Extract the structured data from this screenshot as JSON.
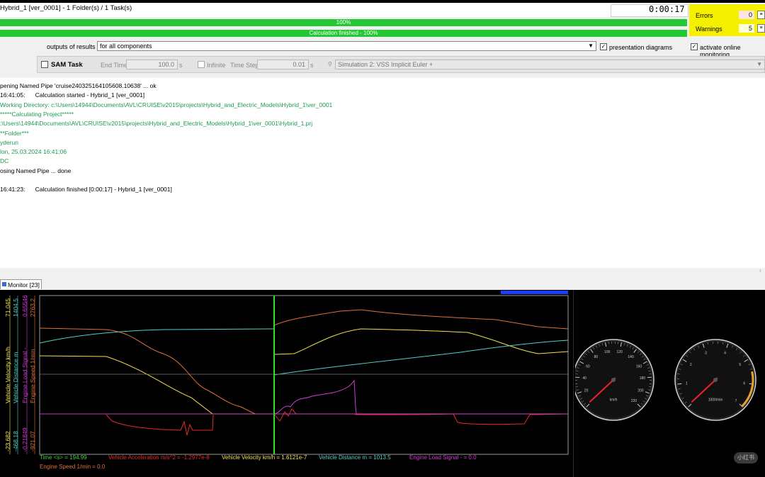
{
  "header": {
    "title": "Hybrid_1 [ver_0001] - 1 Folder(s) / 1 Task(s)",
    "timer": "0:00:17",
    "progress1_label": "100%",
    "progress1": 1.0,
    "progress2_label": "Calculation finished - 100%",
    "progress2": 1.0
  },
  "status": {
    "errors_label": "Errors",
    "errors_value": "0",
    "warnings_label": "Warnings",
    "warnings_value": "5"
  },
  "options": {
    "outputs_label": "outputs of results",
    "outputs_value": "for all components",
    "presentation_label": "presentation diagrams",
    "presentation_checked": true,
    "online_label": "activate online monitoring",
    "online_checked": true
  },
  "task": {
    "name": "SAM Task",
    "end_time_label": "End Time",
    "end_time_value": "100.0",
    "end_time_unit": "s",
    "infinite_label": "Infinite",
    "time_step_label": "Time Step",
    "time_step_value": "0.01",
    "time_step_unit": "s",
    "simulation": "Simulation 2: VSS Implicit Euler +"
  },
  "log": [
    {
      "text": "pening Named Pipe 'cruise240325164105608.10638' ... ok",
      "color": "#000000"
    },
    {
      "text": "16:41:05:      Calculation started - Hybrid_1 [ver_0001]",
      "color": "#000000"
    },
    {
      "text": "Working Directory: c:\\Users\\14944\\Documents\\AVL\\CRUISE\\v2015\\projects\\Hybrid_and_Electric_Models\\Hybrid_1\\ver_0001",
      "color": "#1f9a52"
    },
    {
      "text": "*****Calculating Project*****",
      "color": "#1f9a52"
    },
    {
      "text": ":\\Users\\14944\\Documents\\AVL\\CRUISE\\v2015\\projects\\Hybrid_and_Electric_Models\\Hybrid_1\\ver_0001\\Hybrid_1.prj",
      "color": "#1f9a52"
    },
    {
      "text": "**Folder***",
      "color": "#1f9a52"
    },
    {
      "text": "yderun",
      "color": "#1f9a52"
    },
    {
      "text": "lon, 25.03.2024 16:41:06",
      "color": "#1f9a52"
    },
    {
      "text": "DC",
      "color": "#1f9a52"
    },
    {
      "text": "osing Named Pipe ... done",
      "color": "#000000"
    },
    {
      "text": "",
      "color": "#000000"
    },
    {
      "text": "16:41:23:      Calculation finished [0:00:17] - Hybrid_1 [ver_0001]",
      "color": "#000000"
    }
  ],
  "monitor": {
    "tab_label": "Monitor [23]",
    "axes": [
      {
        "name": "Vehicle Velocity km/h",
        "max": "71.045",
        "min": "-23.682",
        "color": "#f2e14a"
      },
      {
        "name": "Vehicle Distance m",
        "max": "1404.5",
        "min": "-468.18",
        "color": "#4fd3c8"
      },
      {
        "name": "Engine Load Signal -",
        "max": "0.65546",
        "min": "-0.21849",
        "color": "#d23cd2"
      },
      {
        "name": "Engine Speed 1/min",
        "max": "2763.2",
        "min": "-921.07",
        "color": "#e0703a"
      }
    ],
    "legend": [
      {
        "text": "Time <s> = 194.99",
        "color": "#3cd23c"
      },
      {
        "text": "Vehicle Acceleration m/s^2 = -1.2977e-8",
        "color": "#e62a2a"
      },
      {
        "text": "Vehicle Velocity km/h = 1.6121e-7",
        "color": "#f2e14a"
      },
      {
        "text": "Vehicle Distance m = 1013.5",
        "color": "#4fd3c8"
      },
      {
        "text": "Engine Load Signal - = 0.0",
        "color": "#d23cd2"
      },
      {
        "text": "Engine Speed 1/min = 0.0",
        "color": "#e0703a"
      }
    ],
    "speedometer": {
      "unit": "km/h",
      "ticks": [
        "20",
        "40",
        "60",
        "80",
        "100",
        "120",
        "140",
        "160",
        "180",
        "200",
        "220"
      ]
    },
    "tachometer": {
      "unit": "1000/min",
      "ticks": [
        "1",
        "2",
        "3",
        "4",
        "5",
        "6",
        "7"
      ]
    }
  },
  "watermark": "小红书"
}
